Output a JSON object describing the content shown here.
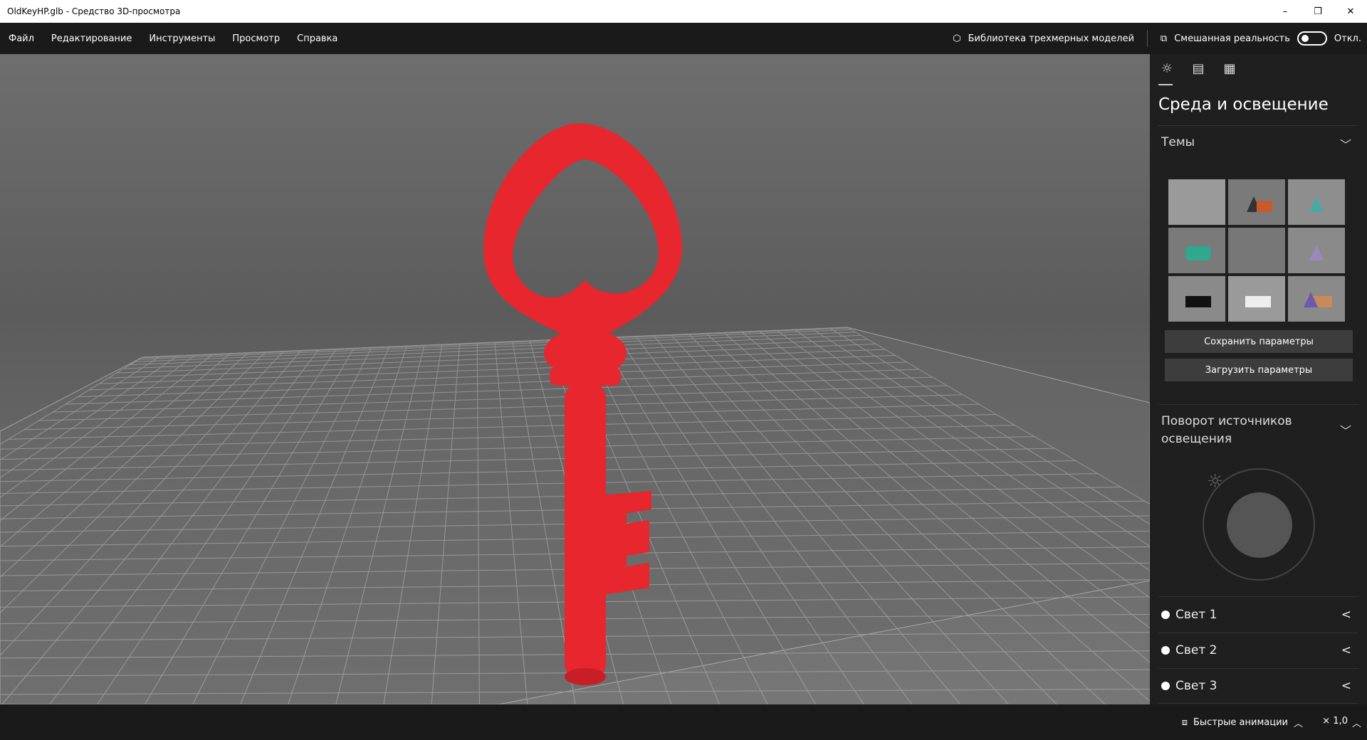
{
  "window": {
    "title": "OldKeyHP.glb - Средство 3D-просмотра",
    "minimize": "–",
    "maximize": "❐",
    "close": "✕"
  },
  "menu": {
    "items": [
      "Файл",
      "Редактирование",
      "Инструменты",
      "Просмотр",
      "Справка"
    ],
    "library": "Библиотека трехмерных моделей",
    "mixed_reality": "Смешанная реальность",
    "toggle_state": "Откл."
  },
  "panel": {
    "title": "Среда и освещение",
    "themes_label": "Темы",
    "save_button": "Сохранить параметры",
    "load_button": "Загрузить параметры",
    "rotation_label_1": "Поворот источников",
    "rotation_label_2": "освещения",
    "lights": [
      "Свет 1",
      "Свет 2",
      "Свет 3"
    ]
  },
  "bottom": {
    "animations": "Быстрые анимации",
    "speed": "× 1,0"
  },
  "colors": {
    "key": "#e8262e",
    "accent": "#ffffff"
  }
}
